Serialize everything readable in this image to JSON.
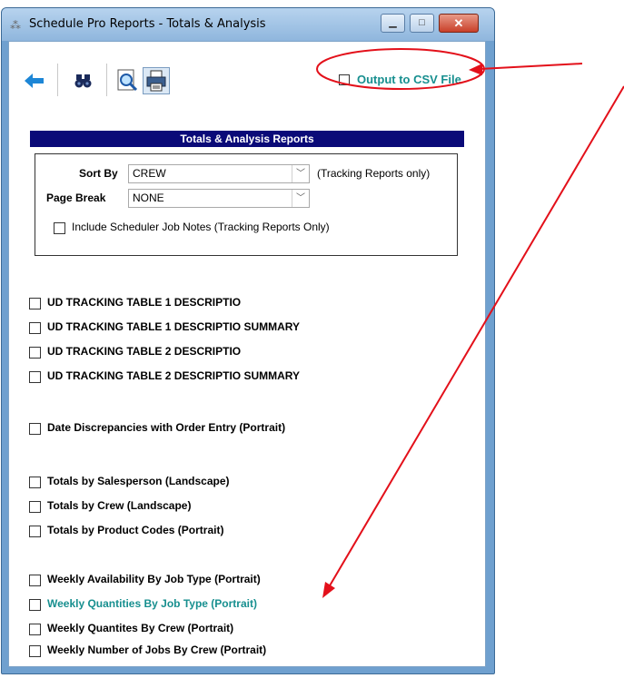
{
  "window": {
    "title": "Schedule Pro Reports - Totals & Analysis",
    "minimize_glyph": "▁",
    "maximize_glyph": "□",
    "close_glyph": "✕"
  },
  "toolbar": {
    "icons": [
      "back-arrow-icon",
      "binoculars-icon",
      "print-preview-icon",
      "printer-icon"
    ],
    "csv_label": "Output to CSV File",
    "csv_checked": false
  },
  "section_title": "Totals & Analysis Reports",
  "options": {
    "sort_by_label": "Sort By",
    "sort_by_value": "CREW",
    "sort_note": "(Tracking Reports only)",
    "page_break_label": "Page Break",
    "page_break_value": "NONE",
    "include_notes_label": "Include Scheduler Job Notes (Tracking Reports Only)",
    "include_notes_checked": false
  },
  "reports": [
    {
      "label": "UD TRACKING TABLE 1 DESCRIPTIO",
      "checked": false
    },
    {
      "label": "UD TRACKING TABLE 1 DESCRIPTIO SUMMARY",
      "checked": false
    },
    {
      "label": "UD TRACKING TABLE 2 DESCRIPTIO",
      "checked": false
    },
    {
      "label": "UD TRACKING TABLE 2 DESCRIPTIO SUMMARY",
      "checked": false
    },
    {
      "label": "Date Discrepancies with Order Entry (Portrait)",
      "checked": false
    },
    {
      "label": "Totals by Salesperson (Landscape)",
      "checked": false
    },
    {
      "label": "Totals by Crew (Landscape)",
      "checked": false
    },
    {
      "label": "Totals by Product Codes (Portrait)",
      "checked": false
    },
    {
      "label": "Weekly Availability By Job Type (Portrait)",
      "checked": false
    },
    {
      "label": "Weekly Quantities By Job Type (Portrait)",
      "checked": false,
      "highlighted": true
    },
    {
      "label": "Weekly Quantites By Crew (Portrait)",
      "checked": false
    },
    {
      "label": "Weekly Number of Jobs By Crew (Portrait)",
      "checked": false
    }
  ],
  "annotations": {
    "color": "#e3101a"
  }
}
